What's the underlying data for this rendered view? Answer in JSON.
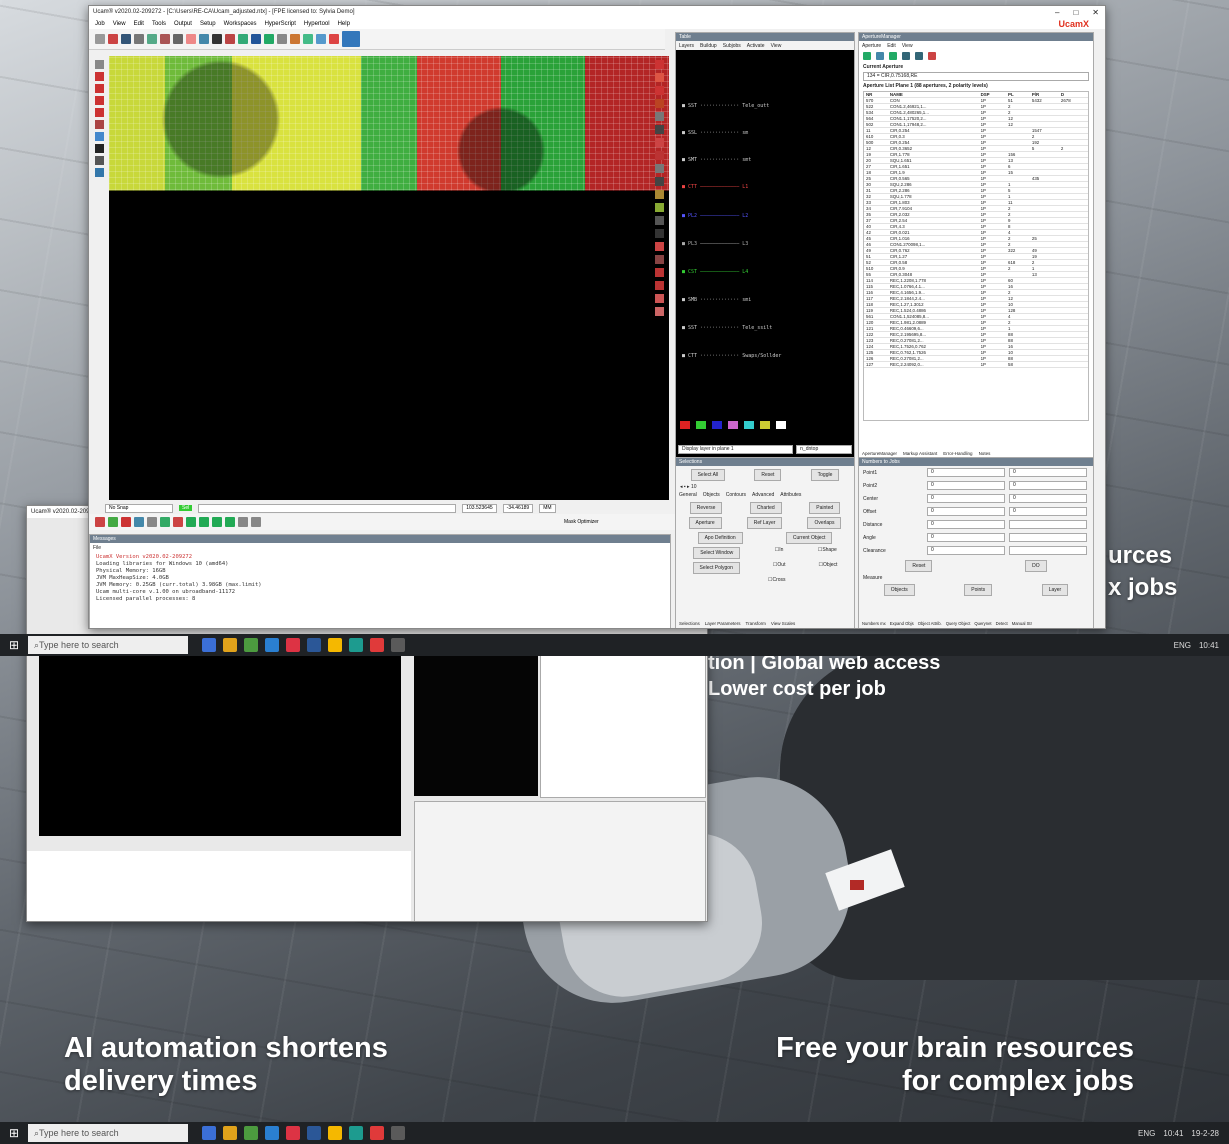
{
  "slogans": {
    "left_line1": "AI automation shortens",
    "left_line2": "delivery times",
    "right_line1": "Free your brain resources",
    "right_line2": "for complex jobs",
    "partial_top1": "tion | Global web access",
    "partial_top2": "Lower cost per job",
    "partial_right1": "urces",
    "partial_right2": "x jobs"
  },
  "taskbar": {
    "search_placeholder": "Type here to search",
    "time": "10:41",
    "date": "19-2-28",
    "lang": "ENG"
  },
  "window": {
    "title": "Ucam® v2020.02-209272 - [C:\\Users\\RE-CA\\Ucam_adjusted.ntx] - [FPE licensed to: Sylvia Demo]",
    "brand": "UcamX",
    "menu": [
      "Job",
      "View",
      "Edit",
      "Tools",
      "Output",
      "Setup",
      "Workspaces",
      "HyperScript",
      "Hypertool",
      "Help"
    ],
    "status": {
      "snap": "No Snap",
      "x": "103.523645",
      "y": "-34.46189",
      "unit": "MM",
      "mask_optimizer": "Mask Optimizer",
      "sel": "Sel"
    }
  },
  "layers_panel": {
    "title": "Table",
    "menu": [
      "Layers",
      "Buildup",
      "Subjobs",
      "Activate",
      "View"
    ],
    "rows": [
      {
        "name": "SST",
        "target": "Tele_outt"
      },
      {
        "name": "SSL",
        "target": "sm"
      },
      {
        "name": "SMT",
        "target": "smt"
      },
      {
        "name": "CTT",
        "target": "L1"
      },
      {
        "name": "PL2",
        "target": "L2"
      },
      {
        "name": "PL3",
        "target": "L3"
      },
      {
        "name": "CST",
        "target": "L4"
      },
      {
        "name": "SMB",
        "target": "smi"
      },
      {
        "name": "SST",
        "target": "Tele_ssilt"
      },
      {
        "name": "CTT",
        "target": "Swaps/Sollder"
      }
    ],
    "display_label": "Display layer in plane 1",
    "display_value": "n_dntop"
  },
  "aperture_panel": {
    "title": "ApertureManager",
    "menu": [
      "Aperture",
      "Edit",
      "View"
    ],
    "current_label": "Current Aperture",
    "current_value": "134 = CIR,0.75168,RE",
    "list_label": "Aperture List Plane 1 (88 apertures, 2 polarity levels)",
    "columns": [
      "NR",
      "NAME",
      "DSP",
      "PL",
      "P/R",
      "D",
      "A",
      "V"
    ],
    "rows": [
      [
        "570",
        "CON",
        "1P",
        "51",
        "5432",
        "2678"
      ],
      [
        "522",
        "CON1.2,46921,1...",
        "1P",
        "2",
        "",
        ""
      ],
      [
        "534",
        "CON1.2,480265,1...",
        "1P",
        "2",
        "",
        ""
      ],
      [
        "564",
        "CON1.1,17520,2...",
        "1P",
        "12",
        "",
        ""
      ],
      [
        "502",
        "CON1.1,17948,2...",
        "1P",
        "12",
        "",
        ""
      ],
      [
        "11",
        "CIR,0.254",
        "1P",
        "",
        "1547",
        ""
      ],
      [
        "610",
        "CIR,0.3",
        "1P",
        "",
        "2",
        ""
      ],
      [
        "500",
        "CIR,0.254",
        "1P",
        "",
        "192",
        ""
      ],
      [
        "12",
        "CIR,0.3652",
        "1P",
        "",
        "5",
        "2"
      ],
      [
        "19",
        "CIR,1.778",
        "1P",
        "156",
        "",
        ""
      ],
      [
        "20",
        "SQU,1.651",
        "1P",
        "13",
        "",
        ""
      ],
      [
        "27",
        "CIR,1.651",
        "1P",
        "6",
        "",
        ""
      ],
      [
        "18",
        "CIR,1.9",
        "1P",
        "15",
        "",
        ""
      ],
      [
        "25",
        "CIR,0.565",
        "1P",
        "",
        "435",
        ""
      ],
      [
        "30",
        "SQU,2.286",
        "1P",
        "1",
        "",
        ""
      ],
      [
        "31",
        "CIR,2.286",
        "1P",
        "5",
        "",
        ""
      ],
      [
        "32",
        "SQU,1.778",
        "1P",
        "1",
        "",
        ""
      ],
      [
        "33",
        "CIR,1.803",
        "1P",
        "11",
        "",
        ""
      ],
      [
        "34",
        "CIR,7.9104",
        "1P",
        "2",
        "",
        ""
      ],
      [
        "35",
        "CIR,2.032",
        "1P",
        "2",
        "",
        ""
      ],
      [
        "37",
        "CIR,2.54",
        "1P",
        "9",
        "",
        ""
      ],
      [
        "40",
        "CIR,4.3",
        "1P",
        "8",
        "",
        ""
      ],
      [
        "42",
        "CIR,0.021",
        "1P",
        "4",
        "",
        ""
      ],
      [
        "45",
        "CIR,1.016",
        "1P",
        "2",
        "25",
        ""
      ],
      [
        "46",
        "CON1.270098,1...",
        "1P",
        "2",
        "",
        ""
      ],
      [
        "49",
        "CIR,0.762",
        "1P",
        "322",
        "49",
        ""
      ],
      [
        "51",
        "CIR,1.27",
        "1P",
        "",
        "19",
        ""
      ],
      [
        "52",
        "CIR,0.58",
        "1P",
        "618",
        "2",
        ""
      ],
      [
        "510",
        "CIR,0.9",
        "1P",
        "2",
        "1",
        ""
      ],
      [
        "55",
        "CIR,0.3048",
        "1P",
        "",
        "13",
        ""
      ],
      [
        "114",
        "REC,1.2208,1.778",
        "1P",
        "60",
        "",
        ""
      ],
      [
        "115",
        "REC,1.0766,4.1...",
        "1P",
        "16",
        "",
        ""
      ],
      [
        "116",
        "REC,4.1656,1.9...",
        "1P",
        "2",
        "",
        ""
      ],
      [
        "117",
        "REC,2.1844,2.4...",
        "1P",
        "12",
        "",
        ""
      ],
      [
        "118",
        "REC,1.27,1.3012",
        "1P",
        "10",
        "",
        ""
      ],
      [
        "119",
        "REC,1.524,0.4886",
        "1P",
        "128",
        "",
        ""
      ],
      [
        "561",
        "CON1.1,524085,8...",
        "1P",
        "4",
        "",
        ""
      ],
      [
        "120",
        "REC,1.981,2.0889",
        "1P",
        "2",
        "",
        ""
      ],
      [
        "121",
        "REC,0.46609,6...",
        "1P",
        "1",
        "",
        ""
      ],
      [
        "122",
        "REC,2.195695,8...",
        "1P",
        "88",
        "",
        ""
      ],
      [
        "123",
        "REC,0.27081,2...",
        "1P",
        "88",
        "",
        ""
      ],
      [
        "124",
        "REC,1.7526,0.762",
        "1P",
        "16",
        "",
        ""
      ],
      [
        "125",
        "REC,0.762,1.7526",
        "1P",
        "10",
        "",
        ""
      ],
      [
        "126",
        "REC,0.27081,2...",
        "1P",
        "88",
        "",
        ""
      ],
      [
        "127",
        "REC,2.24092,0...",
        "1P",
        "58",
        "",
        ""
      ]
    ],
    "tabs": [
      "ApertureManager",
      "Markup Assistant",
      "Error-Handling",
      "Notes"
    ]
  },
  "selections_panel": {
    "title": "Selections",
    "buttons_top": [
      "Select All",
      "Reset",
      "Toggle"
    ],
    "level": "10",
    "tabs": [
      "General",
      "Objects",
      "Contours",
      "Advanced",
      "Attributes"
    ],
    "rows": [
      [
        "Reverse",
        "Charted",
        "Painted"
      ],
      [
        "Aperture",
        "Ref Layer",
        "Overlaps"
      ],
      [
        "Apo Definition",
        "",
        "Current Object"
      ]
    ],
    "select_window": "Select Window",
    "select_polygon": "Select Polygon",
    "checks": [
      "In",
      "Shape",
      "Out",
      "Object",
      "Cross"
    ],
    "footer_tabs": [
      "Selections",
      "Layer Parameters",
      "Transform",
      "View Scales"
    ]
  },
  "numbers_panel": {
    "title": "Numbers to Jobs",
    "fields": [
      {
        "label": "Point1",
        "v1": "0",
        "v2": "0"
      },
      {
        "label": "Point2",
        "v1": "0",
        "v2": "0"
      },
      {
        "label": "Center",
        "v1": "0",
        "v2": "0"
      },
      {
        "label": "Offset",
        "v1": "0",
        "v2": "0"
      },
      {
        "label": "Distance",
        "v1": "0",
        "v2": ""
      },
      {
        "label": "Angle",
        "v1": "0",
        "v2": ""
      },
      {
        "label": "Clearance",
        "v1": "0",
        "v2": ""
      }
    ],
    "reset": "Reset",
    "do": "DO",
    "measure": "Measure",
    "measure_buttons": [
      "Objects",
      "Points",
      "Layer"
    ],
    "footer_tabs": [
      "Numbers mx",
      "Expand Objs",
      "Object Attrib.",
      "Query Object",
      "Querynet",
      "Detect",
      "Manual Str"
    ]
  },
  "messages": {
    "title": "Messages",
    "menu": "File",
    "lines": [
      "UcamX Version v2020.02-209272",
      "Loading libraries for Windows 10 (amd64)",
      "Physical Memory: 16GB",
      "JVM MaxHeapSize: 4.0GB",
      "JVM Memory: 0.25GB (curr.total)  3.98GB (max.limit)",
      "",
      "Ucam multi-core v.1.00 on ubroadband-11172",
      "  Licensed parallel processes:  8"
    ]
  },
  "colors": {
    "accent": "#e0301e",
    "pcb_green": "#3fae40",
    "pcb_red": "#d03a2e",
    "pcb_yellow": "#d9e23f",
    "panel_header": "#6f7f8f"
  }
}
